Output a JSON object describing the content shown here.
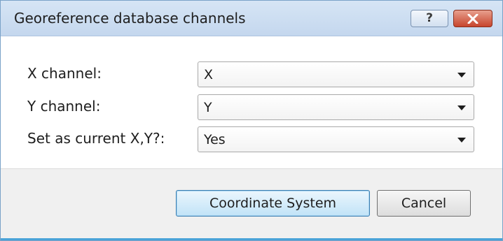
{
  "window": {
    "title": "Georeference database channels",
    "help_glyph": "?",
    "title_color": "#c4d7ee",
    "close_color": "#c7452d"
  },
  "form": {
    "x_channel": {
      "label": "X channel:",
      "value": "X"
    },
    "y_channel": {
      "label": "Y channel:",
      "value": "Y"
    },
    "set_current": {
      "label": "Set as current X,Y?:",
      "value": "Yes"
    }
  },
  "buttons": {
    "coordinate_system": "Coordinate System",
    "cancel": "Cancel"
  },
  "icons": [
    "help-icon",
    "close-icon",
    "dropdown-arrow-icon"
  ]
}
